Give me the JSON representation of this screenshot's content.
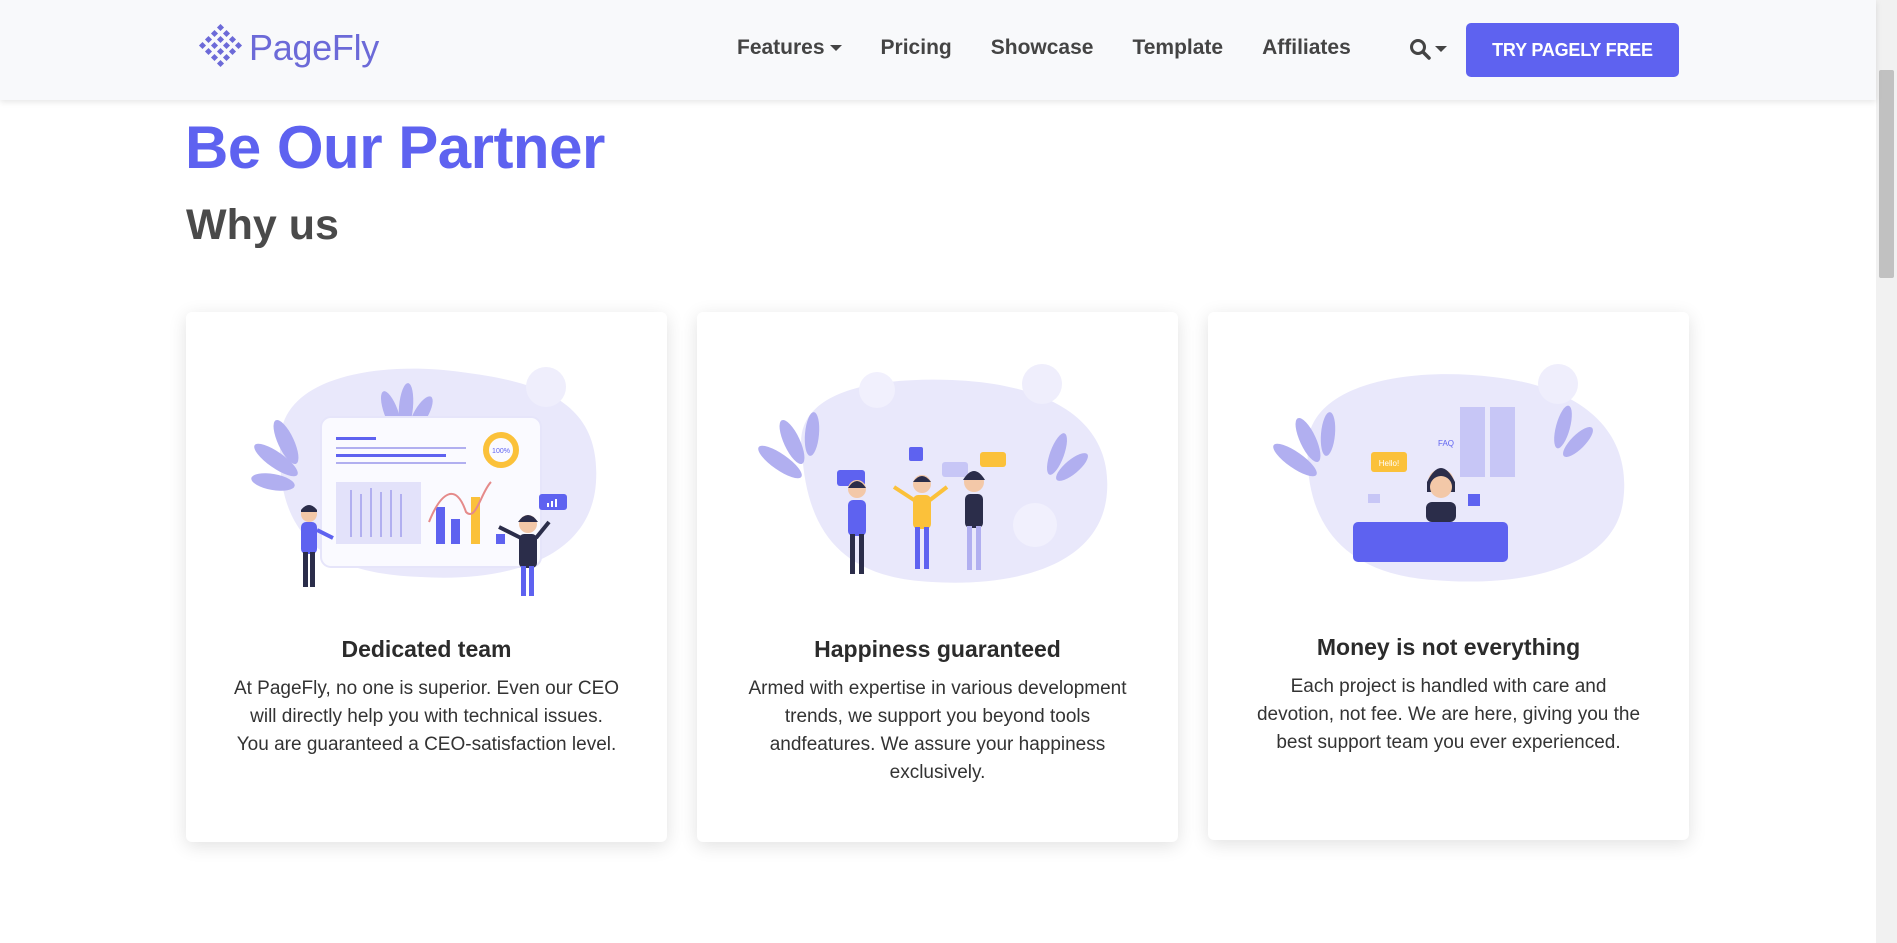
{
  "brand": {
    "name": "PageFly",
    "accent": "#5e62f0",
    "logo_color": "#6c6ad8"
  },
  "nav": {
    "items": [
      {
        "label": "Features",
        "has_dropdown": true
      },
      {
        "label": "Pricing"
      },
      {
        "label": "Showcase"
      },
      {
        "label": "Template"
      },
      {
        "label": "Affiliates"
      }
    ],
    "search_icon": "search-icon",
    "cta_label": "TRY PAGELY FREE"
  },
  "hero": {
    "title": "Be Our Partner",
    "subtitle": "Why us"
  },
  "cards": [
    {
      "title": "Dedicated team",
      "text": "At PageFly, no one is superior. Even our CEO will directly help you with technical issues. You are guaranteed a CEO-satisfaction level.",
      "illustration": "team-dashboard-illustration",
      "illustration_text": "100%"
    },
    {
      "title": "Happiness guaranteed",
      "text": "Armed with expertise in various development trends, we support you beyond tools andfeatures. We assure your happiness exclusively.",
      "illustration": "happy-team-illustration"
    },
    {
      "title": "Money is not everything",
      "text": "Each project is handled with care and devotion, not fee. We are here, giving you the best support team you ever experienced.",
      "illustration": "support-agent-illustration",
      "illustration_labels": {
        "hello": "Hello!",
        "faq": "FAQ"
      }
    }
  ]
}
